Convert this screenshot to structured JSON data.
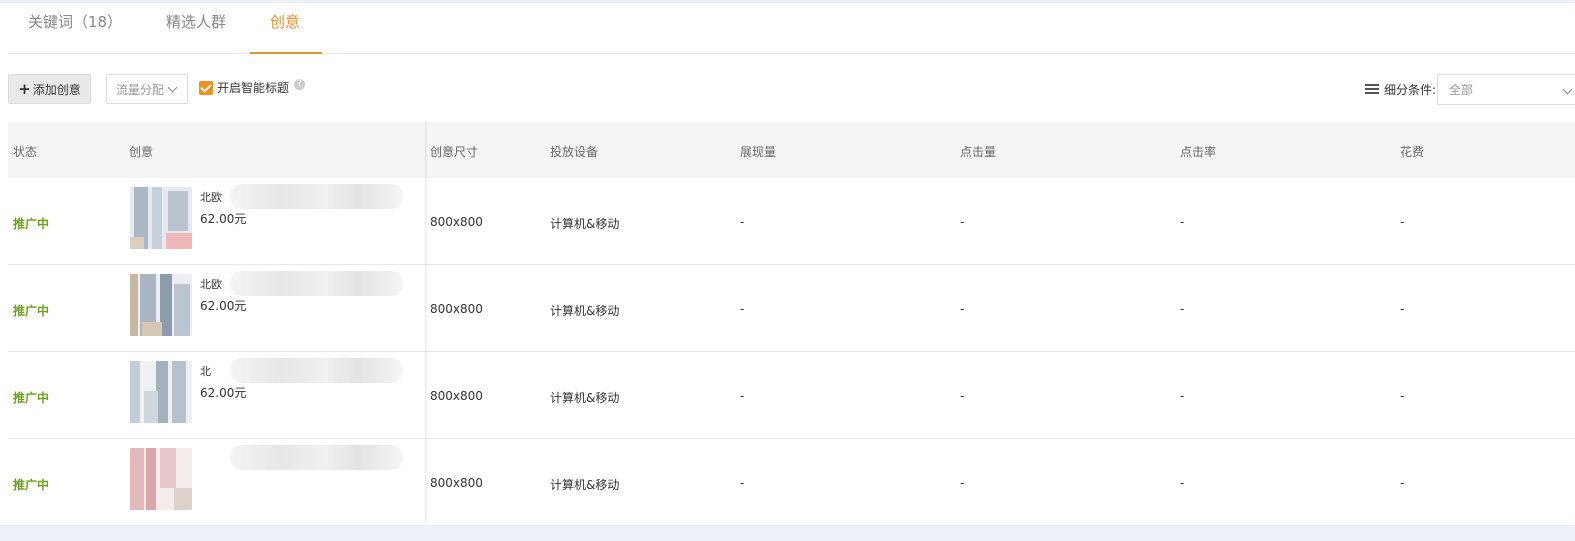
{
  "tabs": [
    {
      "label": "关键词（18）"
    },
    {
      "label": "精选人群"
    },
    {
      "label": "创意",
      "active": true
    }
  ],
  "toolbar": {
    "add_label": "添加创意",
    "flow_select": "流量分配",
    "smart_title_label": "开启智能标题",
    "smart_title_checked": true,
    "filter_label": "细分条件:",
    "filter_value": "全部"
  },
  "table": {
    "headers": {
      "status": "状态",
      "creative": "创意",
      "size": "创意尺寸",
      "device": "投放设备",
      "impressions": "展现量",
      "clicks": "点击量",
      "ctr": "点击率",
      "cost": "花费"
    },
    "rows": [
      {
        "status": "推广中",
        "title": "北欧",
        "price": "62.00元",
        "size": "800x800",
        "device": "计算机&移动",
        "impressions": "-",
        "clicks": "-",
        "ctr": "-",
        "cost": "-"
      },
      {
        "status": "推广中",
        "title": "北欧",
        "price": "62.00元",
        "size": "800x800",
        "device": "计算机&移动",
        "impressions": "-",
        "clicks": "-",
        "ctr": "-",
        "cost": "-"
      },
      {
        "status": "推广中",
        "title": "北",
        "price": "62.00元",
        "size": "800x800",
        "device": "计算机&移动",
        "impressions": "-",
        "clicks": "-",
        "ctr": "-",
        "cost": "-"
      },
      {
        "status": "推广中",
        "title": "",
        "price": "",
        "size": "800x800",
        "device": "计算机&移动",
        "impressions": "-",
        "clicks": "-",
        "ctr": "-",
        "cost": "-"
      }
    ]
  },
  "colors": {
    "accent": "#e8922d",
    "status_active": "#6ba21f",
    "checkbox": "#ef8f1f"
  }
}
